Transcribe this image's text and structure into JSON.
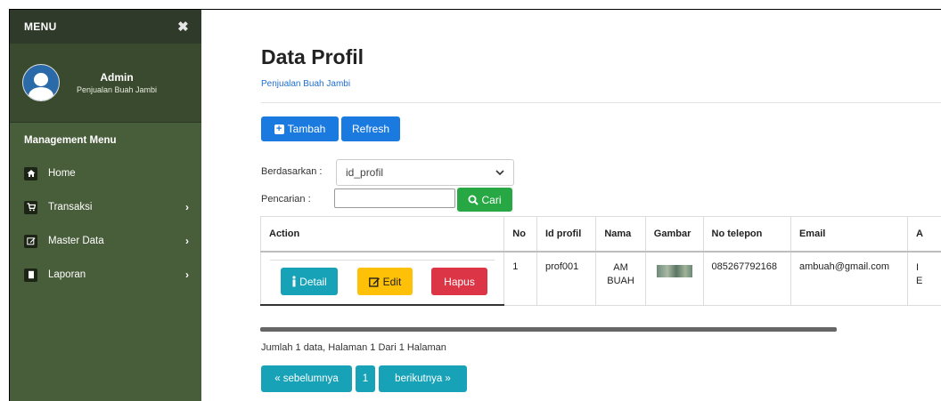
{
  "sidebar": {
    "menu_title": "MENU",
    "close_glyph": "✖",
    "user_name": "Admin",
    "user_subtitle": "Penjualan Buah Jambi",
    "section_title": "Management Menu",
    "items": [
      {
        "label": "Home",
        "icon": "home-icon",
        "glyph": "⌂",
        "arrow": ""
      },
      {
        "label": "Transaksi",
        "icon": "cart-icon",
        "glyph": "🛒",
        "arrow": "›"
      },
      {
        "label": "Master Data",
        "icon": "edit-icon",
        "glyph": "✎",
        "arrow": "›"
      },
      {
        "label": "Laporan",
        "icon": "file-icon",
        "glyph": "▮",
        "arrow": "›"
      }
    ],
    "colors": {
      "bg": "#485d39",
      "header": "#2f3a2a"
    }
  },
  "page": {
    "title": "Data Profil",
    "subtitle": "Penjualan Buah Jambi"
  },
  "toolbar": {
    "add_label": "Tambah",
    "refresh_label": "Refresh"
  },
  "filter": {
    "by_label": "Berdasarkan :",
    "by_value": "id_profil",
    "search_label": "Pencarian   :",
    "search_value": "",
    "search_button": "Cari"
  },
  "table": {
    "headers": [
      "Action",
      "No",
      "Id profil",
      "Nama",
      "Gambar",
      "No telepon",
      "Email",
      "A"
    ],
    "rows": [
      {
        "actions": {
          "detail": "Detail",
          "edit": "Edit",
          "delete": "Hapus"
        },
        "no": "1",
        "id_profil": "prof001",
        "nama_line1": "AM",
        "nama_line2": "BUAH",
        "no_telepon": "085267792168",
        "email": "ambuah@gmail.com",
        "alamat_line1": "I",
        "alamat_line2": "E"
      }
    ]
  },
  "footer": {
    "summary": "Jumlah 1 data, Halaman 1 Dari 1 Halaman",
    "prev_label": "« sebelumnya",
    "page_label": "1",
    "next_label": "berikutnya »"
  },
  "colors": {
    "primary": "#1a7ae0",
    "success": "#28a745",
    "info": "#17a2b8",
    "warning": "#ffc107",
    "danger": "#dc3545"
  }
}
